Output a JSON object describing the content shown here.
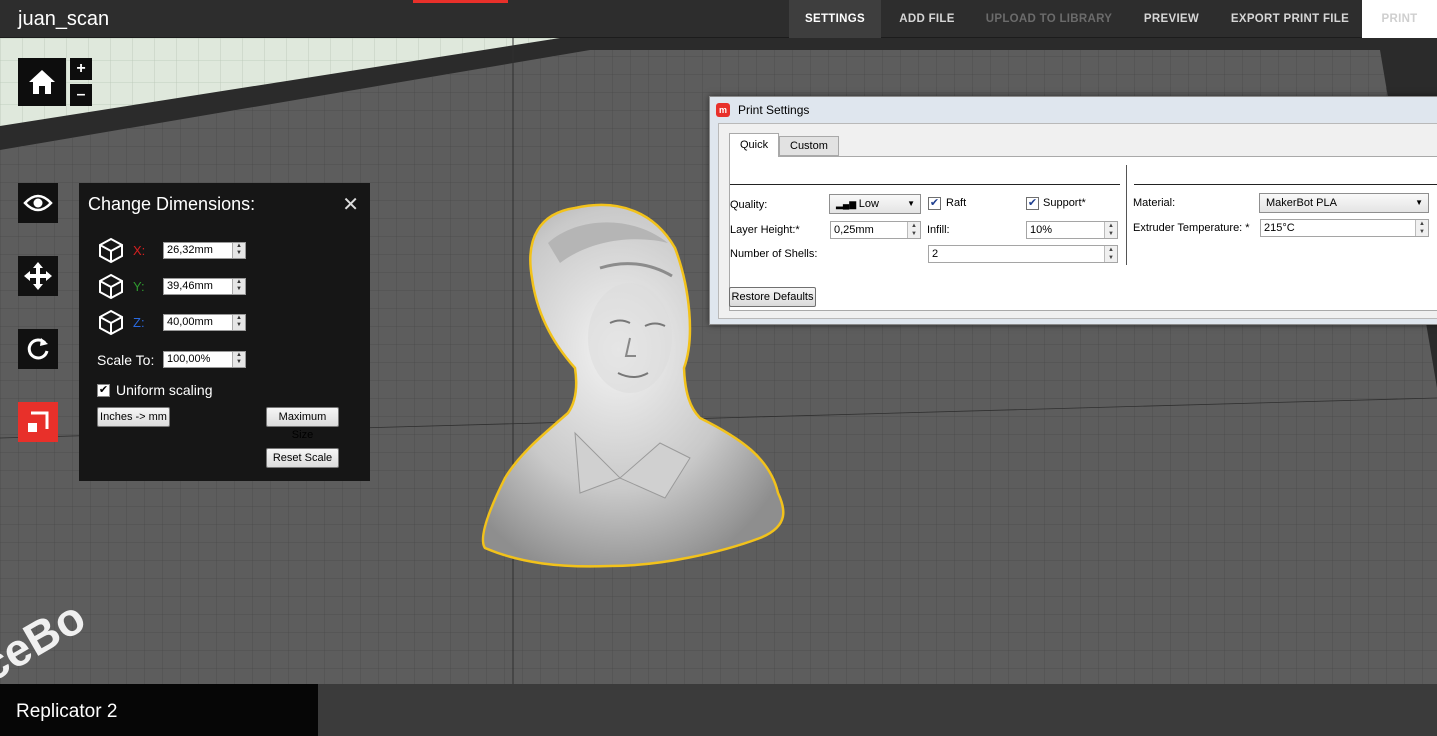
{
  "app": {
    "title": "juan_scan"
  },
  "nav": {
    "settings": "SETTINGS",
    "add_file": "ADD FILE",
    "upload": "UPLOAD TO LIBRARY",
    "preview": "PREVIEW",
    "export": "EXPORT PRINT FILE",
    "print": "PRINT"
  },
  "toolbar": {
    "zoom_in": "+",
    "zoom_out": "–",
    "icons": [
      "home-icon",
      "eye-icon",
      "move-icon",
      "rotate-icon",
      "scale-icon"
    ],
    "active": "scale"
  },
  "dimensions": {
    "title": "Change Dimensions:",
    "close": "✕",
    "x_label": "X:",
    "x_value": "26,32mm",
    "y_label": "Y:",
    "y_value": "39,46mm",
    "z_label": "Z:",
    "z_value": "40,00mm",
    "scale_label": "Scale To:",
    "scale_value": "100,00%",
    "uniform_label": "Uniform scaling",
    "uniform_checked": true,
    "inches_button": "Inches -> mm",
    "max_button": "Maximum Size",
    "reset_button": "Reset Scale",
    "colors": {
      "x": "#d42020",
      "y": "#2e9a2e",
      "z": "#2a6ae0"
    }
  },
  "print_settings": {
    "title": "Print Settings",
    "tabs": [
      "Quick",
      "Custom"
    ],
    "active_tab": "Quick",
    "quality_label": "Quality:",
    "quality_value": "Low",
    "raft_label": "Raft",
    "raft_checked": true,
    "support_label": "Support*",
    "support_checked": true,
    "layer_height_label": "Layer Height:*",
    "layer_height_value": "0,25mm",
    "infill_label": "Infill:",
    "infill_value": "10%",
    "shells_label": "Number of Shells:",
    "shells_value": "2",
    "material_label": "Material:",
    "material_value": "MakerBot PLA",
    "extruder_label": "Extruder Temperature: *",
    "extruder_value": "215°C",
    "restore_button": "Restore Defaults"
  },
  "printer": {
    "name": "Replicator 2"
  },
  "colors": {
    "accent": "#e8302a",
    "selection_outline": "#f2c21b",
    "plate": "#5c5c5c",
    "bed_surround": "#d8e4d4"
  }
}
